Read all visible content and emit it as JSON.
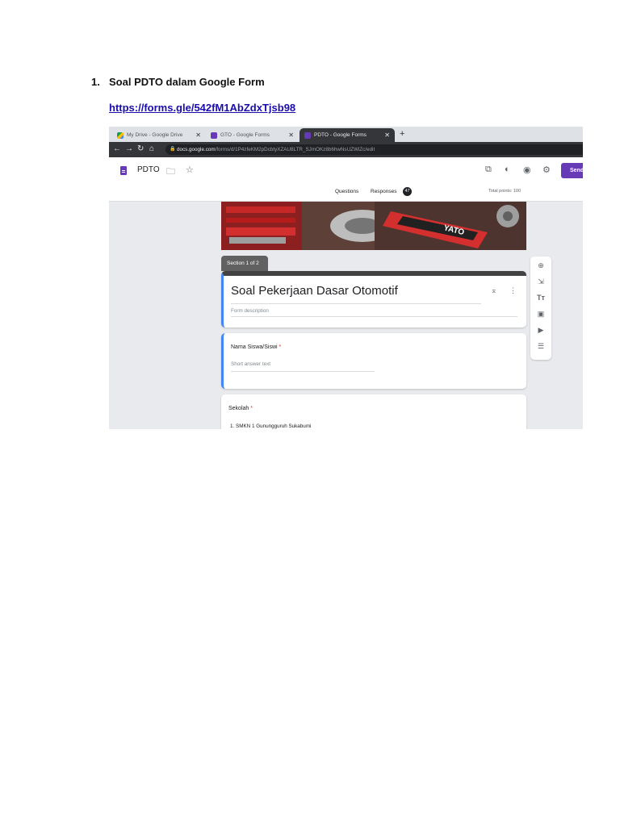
{
  "document": {
    "item_number": "1.",
    "heading": "Soal PDTO dalam Google Form",
    "link": "https://forms.gle/542fM1AbZdxTjsb98"
  },
  "browser": {
    "tabs": [
      {
        "label": "My Drive - Google Drive",
        "icon": "google-drive-icon"
      },
      {
        "label": "GTO - Google Forms",
        "icon": "google-forms-icon"
      },
      {
        "label": "PDTO - Google Forms",
        "icon": "google-forms-icon"
      }
    ],
    "new_tab": "+",
    "url_host": "docs.google.com",
    "url_path": "/forms/d/1P4zfeKM2pDcbtyXZAU8LTR_SJmOKz8b6hwNsUZWiZc/edit"
  },
  "forms": {
    "title": "PDTO",
    "send": "Send",
    "tab_questions": "Questions",
    "tab_responses": "Responses",
    "responses_count": "47",
    "total_points": "Total points: 100",
    "section_label": "Section 1 of 2",
    "form_title": "Soal Pekerjaan Dasar Otomotif",
    "form_description": "Form description",
    "questions": [
      {
        "label": "Nama Siswa/Siswi",
        "required": "*",
        "answer": "Short answer text"
      },
      {
        "label": "Sekolah",
        "required": "*",
        "option": "1.   SMKN 1 Gunungguruh Sukabumi"
      }
    ],
    "banner_text": "YATO"
  },
  "colors": {
    "accent": "#673ab7",
    "link": "#1a0dab",
    "focus_bar": "#4285f4",
    "required": "#d93025"
  }
}
